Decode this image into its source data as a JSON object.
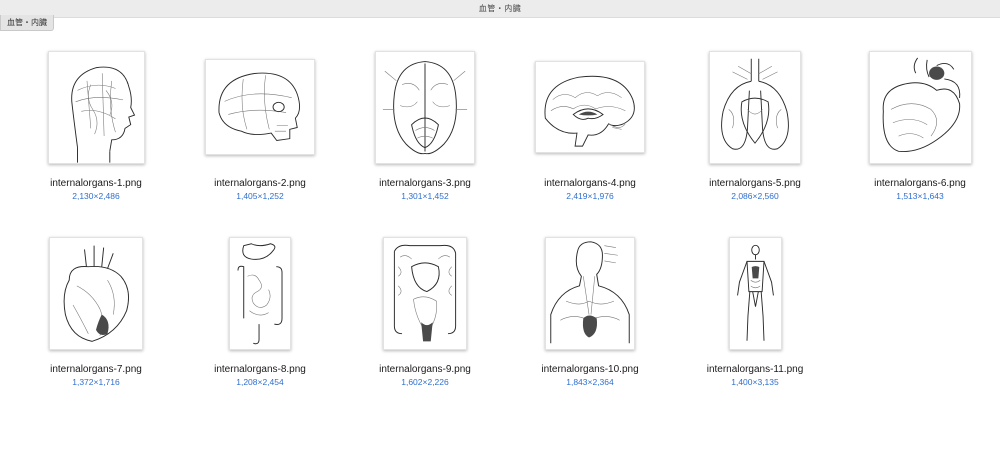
{
  "window": {
    "title": "血管・内臓"
  },
  "folder_tab": {
    "label": "血管・内臓"
  },
  "files": [
    {
      "name": "internalorgans-1.png",
      "dims": "2,130×2,486",
      "icon": "head-vessels-icon"
    },
    {
      "name": "internalorgans-2.png",
      "dims": "1,405×1,252",
      "icon": "skull-side-icon"
    },
    {
      "name": "internalorgans-3.png",
      "dims": "1,301×1,452",
      "icon": "brain-base-icon"
    },
    {
      "name": "internalorgans-4.png",
      "dims": "2,419×1,976",
      "icon": "brain-section-icon"
    },
    {
      "name": "internalorgans-5.png",
      "dims": "2,086×2,560",
      "icon": "lungs-heart-icon"
    },
    {
      "name": "internalorgans-6.png",
      "dims": "1,513×1,643",
      "icon": "heart-section-icon"
    },
    {
      "name": "internalorgans-7.png",
      "dims": "1,372×1,716",
      "icon": "heart-icon"
    },
    {
      "name": "internalorgans-8.png",
      "dims": "1,208×2,454",
      "icon": "digestive-icon"
    },
    {
      "name": "internalorgans-9.png",
      "dims": "1,602×2,226",
      "icon": "intestines-icon"
    },
    {
      "name": "internalorgans-10.png",
      "dims": "1,843×2,364",
      "icon": "neck-torso-icon"
    },
    {
      "name": "internalorgans-11.png",
      "dims": "1,400×3,135",
      "icon": "body-figure-icon"
    }
  ]
}
